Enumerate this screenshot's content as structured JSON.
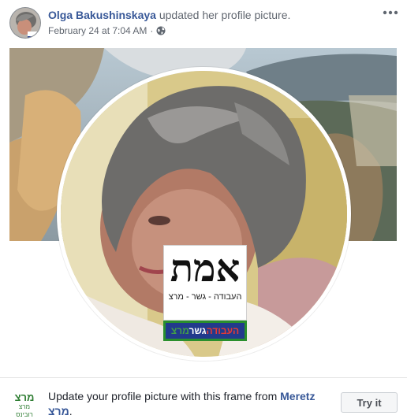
{
  "post": {
    "author_name": "Olga Bakushinskaya",
    "action_text": "updated her profile picture.",
    "timestamp": "February 24 at 7:04 AM",
    "separator": "·",
    "privacy_icon": "globe-icon",
    "more_icon": "more-options-icon"
  },
  "frame_badge": {
    "big_text": "אמת",
    "small_text": "העבודה - גשר - מרצ",
    "strip_part1": "העבודה",
    "strip_part2": "גשר",
    "strip_part3": "מרצ"
  },
  "frame_promo": {
    "logo_text": "מרצ",
    "logo_subtext": "מרצ רובינס",
    "text_before": "Update your profile picture with this frame from ",
    "page_name": "Meretz מרצ",
    "text_after": ".",
    "button_label": "Try it"
  },
  "colors": {
    "link_blue": "#385898",
    "meta_gray": "#616770",
    "badge_navy": "#223a8c",
    "badge_green": "#2a8f2d"
  }
}
